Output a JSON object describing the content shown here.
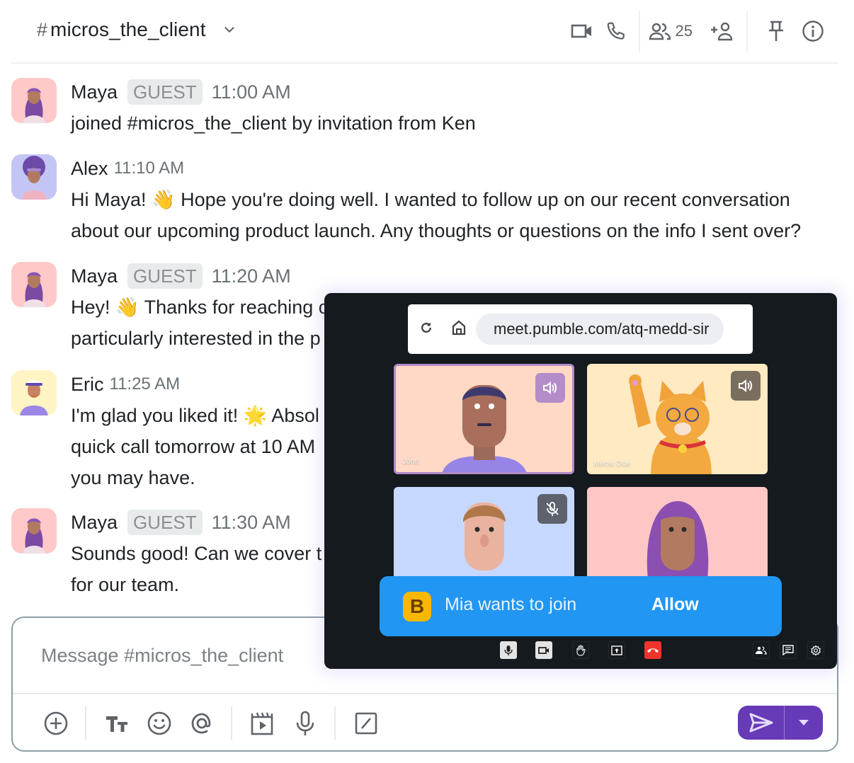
{
  "header": {
    "hash": "#",
    "channel_name": "micros_the_client",
    "member_count": "25",
    "icons": [
      "video-icon",
      "phone-icon",
      "members-icon",
      "add-member-icon",
      "pin-icon",
      "info-icon"
    ]
  },
  "messages": [
    {
      "author": "Maya",
      "badge": "GUEST",
      "time": "11:00 AM",
      "text": "joined #micros_the_client by invitation from Ken",
      "avatar_bg": "#ffc9c9"
    },
    {
      "author": "Alex",
      "badge": "",
      "time": "11:10 AM",
      "text": "Hi Maya! 👋 Hope you're doing well. I wanted to follow up on our recent conversation\nabout our upcoming product launch. Any thoughts or questions on the info I sent over?",
      "avatar_bg": "#c3c6f5"
    },
    {
      "author": "Maya",
      "badge": "GUEST",
      "time": "11:20 AM",
      "text": "Hey! 👋 Thanks for reaching o\nparticularly interested in the p",
      "avatar_bg": "#ffc9c9"
    },
    {
      "author": "Eric",
      "badge": "",
      "time": "11:25 AM",
      "text": "I'm glad you liked it! 🌟 Absol\nquick call tomorrow at 10 AM\nyou may have.",
      "avatar_bg": "#fff4c4"
    },
    {
      "author": "Maya",
      "badge": "GUEST",
      "time": "11:30 AM",
      "text": "Sounds good! Can we cover t\nfor our team.",
      "avatar_bg": "#ffc9c9"
    }
  ],
  "composer": {
    "placeholder": "Message #micros_the_client",
    "tools": [
      "add-icon",
      "text-format-icon",
      "emoji-icon",
      "mention-icon",
      "clip-icon",
      "mic-icon",
      "slash-command-icon"
    ],
    "send_color": "#673ab7"
  },
  "meeting": {
    "url": "meet.pumble.com/atq-medd-sir",
    "participants": [
      {
        "name": "John",
        "bg": "#ffd9c5",
        "audio": "speaking",
        "active": true
      },
      {
        "name": "Meow Doe",
        "bg": "#ffeac2",
        "audio": "speaking",
        "active": false
      },
      {
        "name": "",
        "bg": "#c7d8ff",
        "audio": "muted",
        "active": false
      },
      {
        "name": "",
        "bg": "#ffc6c6",
        "audio": "",
        "active": false
      }
    ],
    "join_request": {
      "avatar_letter": "B",
      "text": "Mia wants to join",
      "action": "Allow",
      "color": "#2196f3"
    },
    "controls": [
      "mic-icon",
      "camera-icon",
      "raise-hand-icon",
      "share-screen-icon",
      "hang-up-icon",
      "participants-icon",
      "chat-icon",
      "settings-icon"
    ]
  }
}
